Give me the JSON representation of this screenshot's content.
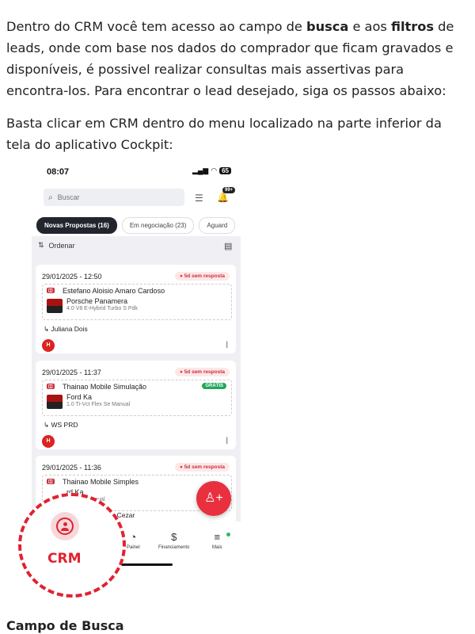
{
  "intro": {
    "p1_before_busca": "Dentro do CRM você tem acesso ao campo de ",
    "busca": "busca",
    "p1_between": " e aos ",
    "filtros": "filtros",
    "p1_after": " de leads, onde com base nos dados do comprador que ficam gravados e disponíveis, é possivel realizar consultas mais assertivas para encontra-los. Para encontrar o lead desejado, siga os passos abaixo:",
    "p2": "Basta clicar em CRM dentro do menu localizado na parte inferior da tela do aplicativo Cockpit:"
  },
  "phone": {
    "time": "08:07",
    "battery": "65",
    "search_placeholder": "Buscar",
    "notif_badge": "99+",
    "tabs": [
      {
        "label": "Novas Propostas (16)"
      },
      {
        "label": "Em negociação (23)"
      },
      {
        "label": "Aguard"
      }
    ],
    "sort_label": "Ordenar",
    "cards": [
      {
        "date": "29/01/2025 - 12:50",
        "status": "5d sem resposta",
        "customer": "Estefano Aloisio Amaro Cardoso",
        "model": "Porsche Panamera",
        "version": "4.0 V8 E-Hybrid Turbo S Pdk",
        "seller": "Juliana Dois",
        "free": ""
      },
      {
        "date": "29/01/2025 - 11:37",
        "status": "5d sem resposta",
        "customer": "Thainao Mobile Simulação",
        "model": "Ford Ka",
        "version": "1.0 Ti-Vct Flex Se Manual",
        "seller": "WS PRD",
        "free": "GRÁTIS"
      },
      {
        "date": "29/01/2025 - 11:36",
        "status": "5d sem resposta",
        "customer": "Thainao Mobile Simples",
        "model": "rd Ka",
        "version": "Flex Se Manual",
        "seller": "s Cezar",
        "free": ""
      }
    ],
    "nav": {
      "painel": "Painel",
      "financiamento": "Financiamento",
      "mais": "Mais"
    },
    "crm_label": "CRM"
  },
  "section_title": "Campo de Busca",
  "colors": {
    "accent": "#e02231",
    "dark_tab": "#23252e",
    "free_badge": "#20a85a"
  }
}
